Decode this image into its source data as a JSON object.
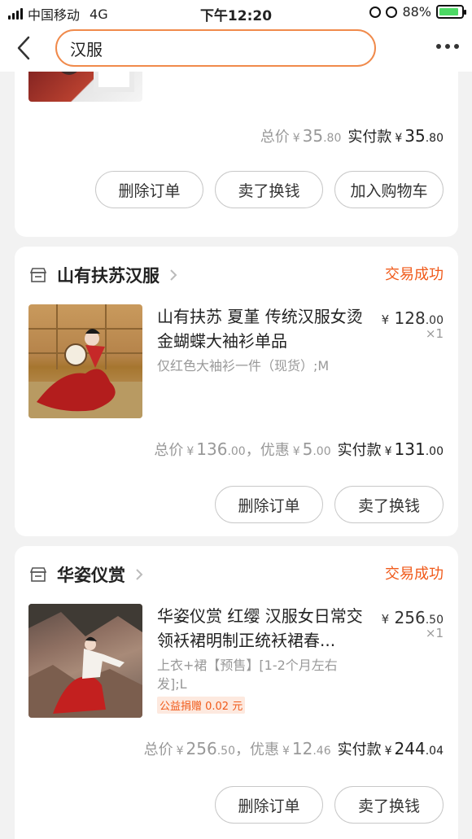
{
  "status_bar": {
    "carrier": "中国移动",
    "network": "4G",
    "time": "下午12:20",
    "battery": "88%"
  },
  "nav": {
    "search_value": "汉服"
  },
  "orders": [
    {
      "total_label": "总价",
      "total_int": "35",
      "total_dec": ".80",
      "paid_label": "实付款",
      "paid_int": "35",
      "paid_dec": ".80",
      "buttons": [
        "删除订单",
        "卖了换钱",
        "加入购物车"
      ]
    },
    {
      "shop": "山有扶苏汉服",
      "status": "交易成功",
      "title": "山有扶苏 夏堇 传统汉服女烫金蝴蝶大袖衫单品",
      "spec": "仅红色大袖衫一件（现货）;M",
      "price_int": "128",
      "price_dec": ".00",
      "qty": "×1",
      "total_label": "总价",
      "total_int": "136",
      "total_dec": ".00",
      "discount_label": "，优惠",
      "discount_int": "5",
      "discount_dec": ".00",
      "paid_label": "实付款",
      "paid_int": "131",
      "paid_dec": ".00",
      "buttons": [
        "删除订单",
        "卖了换钱"
      ]
    },
    {
      "shop": "华姿仪赏",
      "status": "交易成功",
      "title": "华姿仪赏 红缨 汉服女日常交领袄裙明制正统袄裙春...",
      "spec": "上衣+裙【预售】[1-2个月左右发];L",
      "charity": "公益捐赠 0.02 元",
      "price_int": "256",
      "price_dec": ".50",
      "qty": "×1",
      "total_label": "总价",
      "total_int": "256",
      "total_dec": ".50",
      "discount_label": "，优惠",
      "discount_int": "12",
      "discount_dec": ".46",
      "paid_label": "实付款",
      "paid_int": "244",
      "paid_dec": ".04",
      "buttons": [
        "删除订单",
        "卖了换钱"
      ]
    }
  ],
  "currency": "¥",
  "colors": {
    "accent": "#f05a1a",
    "search_border": "#f08a4b",
    "background": "#f2f2f2"
  }
}
